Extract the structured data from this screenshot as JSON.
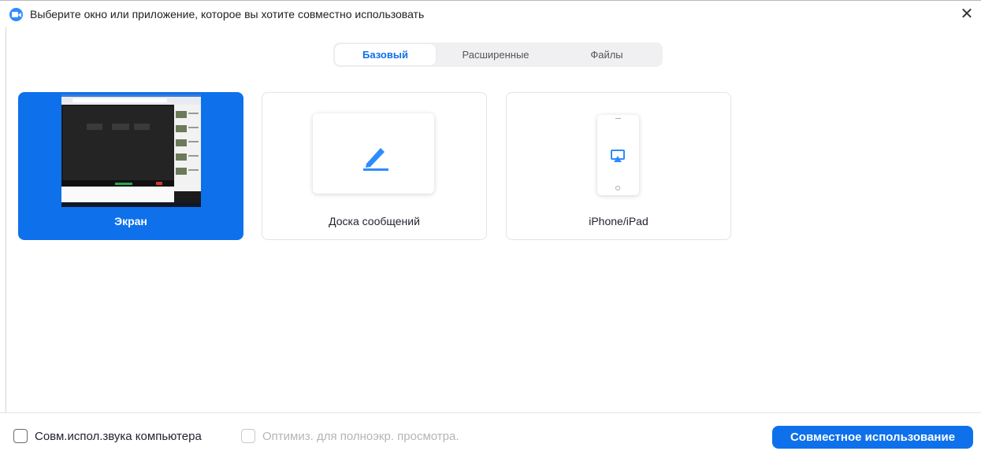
{
  "window": {
    "title": "Выберите окно или приложение, которое вы хотите совместно использовать",
    "close_glyph": "✕",
    "app_icon": "zoom-camera-icon"
  },
  "tabs": [
    {
      "label": "Базовый",
      "active": true
    },
    {
      "label": "Расширенные",
      "active": false
    },
    {
      "label": "Файлы",
      "active": false
    }
  ],
  "share_options": [
    {
      "label": "Экран",
      "selected": true,
      "icon": "screen-thumbnail"
    },
    {
      "label": "Доска сообщений",
      "selected": false,
      "icon": "pencil-icon"
    },
    {
      "label": "iPhone/iPad",
      "selected": false,
      "icon": "airplay-icon"
    }
  ],
  "footer": {
    "share_sound_label": "Совм.испол.звука компьютера",
    "share_sound_checked": false,
    "optimize_label": "Оптимиз. для полноэкр. просмотра.",
    "optimize_enabled": false,
    "share_button": "Совместное использование"
  },
  "colors": {
    "accent": "#0e71eb",
    "selected_card_bg": "#0e71eb",
    "tab_bg": "#f0f0f2"
  }
}
